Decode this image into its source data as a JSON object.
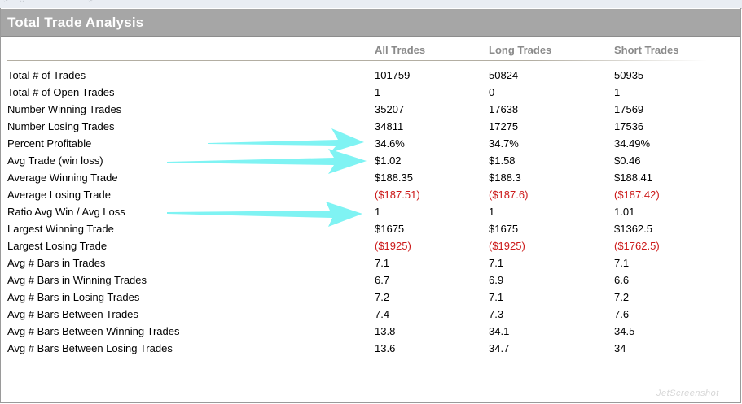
{
  "panel": {
    "title": "Total Trade Analysis",
    "columns": [
      "All Trades",
      "Long Trades",
      "Short Trades"
    ]
  },
  "rows": [
    {
      "label": "Total # of Trades",
      "values": [
        "101759",
        "50824",
        "50935"
      ],
      "negative": false
    },
    {
      "label": "Total # of Open Trades",
      "values": [
        "1",
        "0",
        "1"
      ],
      "negative": false
    },
    {
      "label": "Number Winning Trades",
      "values": [
        "35207",
        "17638",
        "17569"
      ],
      "negative": false
    },
    {
      "label": "Number Losing Trades",
      "values": [
        "34811",
        "17275",
        "17536"
      ],
      "negative": false
    },
    {
      "label": "Percent Profitable",
      "values": [
        "34.6%",
        "34.7%",
        "34.49%"
      ],
      "negative": false
    },
    {
      "label": "Avg Trade (win  loss)",
      "values": [
        "$1.02",
        "$1.58",
        "$0.46"
      ],
      "negative": false
    },
    {
      "label": "Average Winning Trade",
      "values": [
        "$188.35",
        "$188.3",
        "$188.41"
      ],
      "negative": false
    },
    {
      "label": "Average Losing Trade",
      "values": [
        "($187.51)",
        "($187.6)",
        "($187.42)"
      ],
      "negative": true
    },
    {
      "label": "Ratio Avg Win / Avg Loss",
      "values": [
        "1",
        "1",
        "1.01"
      ],
      "negative": false
    },
    {
      "label": "Largest Winning Trade",
      "values": [
        "$1675",
        "$1675",
        "$1362.5"
      ],
      "negative": false
    },
    {
      "label": "Largest Losing Trade",
      "values": [
        "($1925)",
        "($1925)",
        "($1762.5)"
      ],
      "negative": true
    },
    {
      "label": "Avg # Bars in Trades",
      "values": [
        "7.1",
        "7.1",
        "7.1"
      ],
      "negative": false
    },
    {
      "label": "Avg # Bars in Winning Trades",
      "values": [
        "6.7",
        "6.9",
        "6.6"
      ],
      "negative": false
    },
    {
      "label": "Avg # Bars in Losing Trades",
      "values": [
        "7.2",
        "7.1",
        "7.2"
      ],
      "negative": false
    },
    {
      "label": "Avg # Bars Between Trades",
      "values": [
        "7.4",
        "7.3",
        "7.6"
      ],
      "negative": false
    },
    {
      "label": "Avg # Bars Between Winning Trades",
      "values": [
        "13.8",
        "34.1",
        "34.5"
      ],
      "negative": false
    },
    {
      "label": "Avg # Bars Between Losing Trades",
      "values": [
        "13.6",
        "34.7",
        "34"
      ],
      "negative": false
    }
  ],
  "annotations": {
    "arrow_color": "#7ff3f3",
    "arrow_rows": [
      "Percent Profitable",
      "Avg Trade (win  loss)",
      "Ratio Avg Win / Avg Loss"
    ]
  },
  "watermark": "JetScreenshot",
  "colors": {
    "title_bar": "#a6a6a6",
    "header_text": "#8a8a8a",
    "negative": "#cc1a1a"
  }
}
